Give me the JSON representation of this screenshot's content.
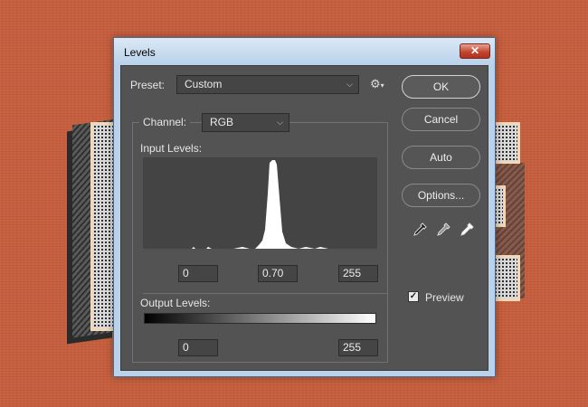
{
  "window": {
    "title": "Levels",
    "close_glyph": "✕"
  },
  "preset": {
    "label": "Preset:",
    "value": "Custom"
  },
  "channel": {
    "label": "Channel:",
    "value": "RGB"
  },
  "input_levels": {
    "label": "Input Levels:",
    "black": "0",
    "gamma": "0.70",
    "white": "255"
  },
  "output_levels": {
    "label": "Output Levels:",
    "black": "0",
    "white": "255"
  },
  "buttons": {
    "ok": "OK",
    "cancel": "Cancel",
    "auto": "Auto",
    "options": "Options..."
  },
  "preview": {
    "label": "Preview",
    "checked": true,
    "check_glyph": "✓"
  },
  "icons": {
    "gear": "⚙",
    "chevron": "⌵",
    "eyedroppers": [
      "black-point-eyedropper-icon",
      "gray-point-eyedropper-icon",
      "white-point-eyedropper-icon"
    ]
  },
  "colors": {
    "dialog_bg": "#535353",
    "titlebar": "#b9d1ea",
    "close": "#c2412a",
    "canvas": "#c65f3e"
  }
}
